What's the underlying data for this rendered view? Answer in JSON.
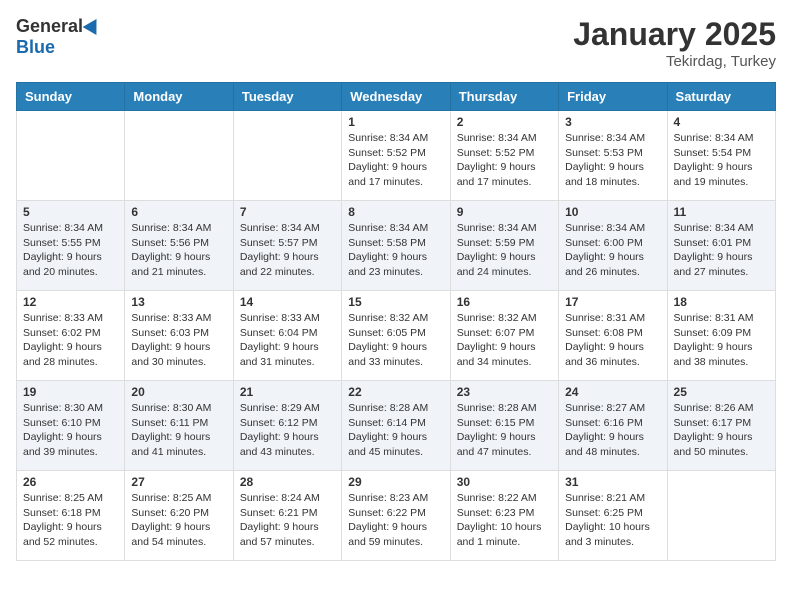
{
  "header": {
    "logo_general": "General",
    "logo_blue": "Blue",
    "month_title": "January 2025",
    "location": "Tekirdag, Turkey"
  },
  "days_of_week": [
    "Sunday",
    "Monday",
    "Tuesday",
    "Wednesday",
    "Thursday",
    "Friday",
    "Saturday"
  ],
  "weeks": [
    [
      {
        "day": "",
        "info": ""
      },
      {
        "day": "",
        "info": ""
      },
      {
        "day": "",
        "info": ""
      },
      {
        "day": "1",
        "info": "Sunrise: 8:34 AM\nSunset: 5:52 PM\nDaylight: 9 hours\nand 17 minutes."
      },
      {
        "day": "2",
        "info": "Sunrise: 8:34 AM\nSunset: 5:52 PM\nDaylight: 9 hours\nand 17 minutes."
      },
      {
        "day": "3",
        "info": "Sunrise: 8:34 AM\nSunset: 5:53 PM\nDaylight: 9 hours\nand 18 minutes."
      },
      {
        "day": "4",
        "info": "Sunrise: 8:34 AM\nSunset: 5:54 PM\nDaylight: 9 hours\nand 19 minutes."
      }
    ],
    [
      {
        "day": "5",
        "info": "Sunrise: 8:34 AM\nSunset: 5:55 PM\nDaylight: 9 hours\nand 20 minutes."
      },
      {
        "day": "6",
        "info": "Sunrise: 8:34 AM\nSunset: 5:56 PM\nDaylight: 9 hours\nand 21 minutes."
      },
      {
        "day": "7",
        "info": "Sunrise: 8:34 AM\nSunset: 5:57 PM\nDaylight: 9 hours\nand 22 minutes."
      },
      {
        "day": "8",
        "info": "Sunrise: 8:34 AM\nSunset: 5:58 PM\nDaylight: 9 hours\nand 23 minutes."
      },
      {
        "day": "9",
        "info": "Sunrise: 8:34 AM\nSunset: 5:59 PM\nDaylight: 9 hours\nand 24 minutes."
      },
      {
        "day": "10",
        "info": "Sunrise: 8:34 AM\nSunset: 6:00 PM\nDaylight: 9 hours\nand 26 minutes."
      },
      {
        "day": "11",
        "info": "Sunrise: 8:34 AM\nSunset: 6:01 PM\nDaylight: 9 hours\nand 27 minutes."
      }
    ],
    [
      {
        "day": "12",
        "info": "Sunrise: 8:33 AM\nSunset: 6:02 PM\nDaylight: 9 hours\nand 28 minutes."
      },
      {
        "day": "13",
        "info": "Sunrise: 8:33 AM\nSunset: 6:03 PM\nDaylight: 9 hours\nand 30 minutes."
      },
      {
        "day": "14",
        "info": "Sunrise: 8:33 AM\nSunset: 6:04 PM\nDaylight: 9 hours\nand 31 minutes."
      },
      {
        "day": "15",
        "info": "Sunrise: 8:32 AM\nSunset: 6:05 PM\nDaylight: 9 hours\nand 33 minutes."
      },
      {
        "day": "16",
        "info": "Sunrise: 8:32 AM\nSunset: 6:07 PM\nDaylight: 9 hours\nand 34 minutes."
      },
      {
        "day": "17",
        "info": "Sunrise: 8:31 AM\nSunset: 6:08 PM\nDaylight: 9 hours\nand 36 minutes."
      },
      {
        "day": "18",
        "info": "Sunrise: 8:31 AM\nSunset: 6:09 PM\nDaylight: 9 hours\nand 38 minutes."
      }
    ],
    [
      {
        "day": "19",
        "info": "Sunrise: 8:30 AM\nSunset: 6:10 PM\nDaylight: 9 hours\nand 39 minutes."
      },
      {
        "day": "20",
        "info": "Sunrise: 8:30 AM\nSunset: 6:11 PM\nDaylight: 9 hours\nand 41 minutes."
      },
      {
        "day": "21",
        "info": "Sunrise: 8:29 AM\nSunset: 6:12 PM\nDaylight: 9 hours\nand 43 minutes."
      },
      {
        "day": "22",
        "info": "Sunrise: 8:28 AM\nSunset: 6:14 PM\nDaylight: 9 hours\nand 45 minutes."
      },
      {
        "day": "23",
        "info": "Sunrise: 8:28 AM\nSunset: 6:15 PM\nDaylight: 9 hours\nand 47 minutes."
      },
      {
        "day": "24",
        "info": "Sunrise: 8:27 AM\nSunset: 6:16 PM\nDaylight: 9 hours\nand 48 minutes."
      },
      {
        "day": "25",
        "info": "Sunrise: 8:26 AM\nSunset: 6:17 PM\nDaylight: 9 hours\nand 50 minutes."
      }
    ],
    [
      {
        "day": "26",
        "info": "Sunrise: 8:25 AM\nSunset: 6:18 PM\nDaylight: 9 hours\nand 52 minutes."
      },
      {
        "day": "27",
        "info": "Sunrise: 8:25 AM\nSunset: 6:20 PM\nDaylight: 9 hours\nand 54 minutes."
      },
      {
        "day": "28",
        "info": "Sunrise: 8:24 AM\nSunset: 6:21 PM\nDaylight: 9 hours\nand 57 minutes."
      },
      {
        "day": "29",
        "info": "Sunrise: 8:23 AM\nSunset: 6:22 PM\nDaylight: 9 hours\nand 59 minutes."
      },
      {
        "day": "30",
        "info": "Sunrise: 8:22 AM\nSunset: 6:23 PM\nDaylight: 10 hours\nand 1 minute."
      },
      {
        "day": "31",
        "info": "Sunrise: 8:21 AM\nSunset: 6:25 PM\nDaylight: 10 hours\nand 3 minutes."
      },
      {
        "day": "",
        "info": ""
      }
    ]
  ]
}
